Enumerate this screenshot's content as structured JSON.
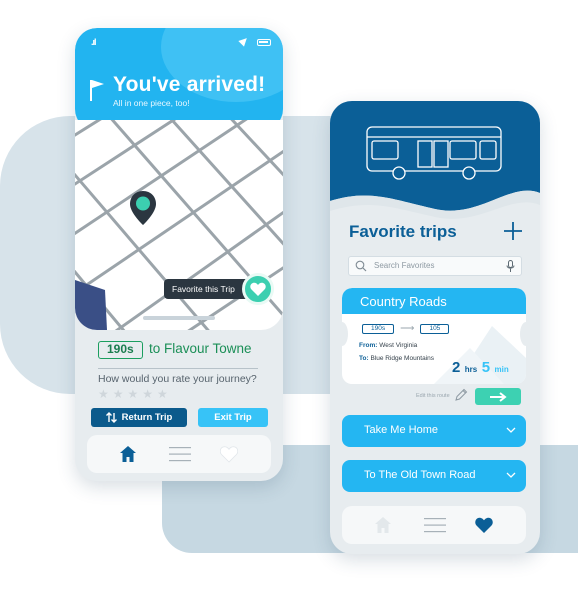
{
  "arrival_screen": {
    "title": "You've arrived!",
    "subtitle": "All in one piece, too!",
    "favorite_tag": "Favorite this Trip",
    "route_badge": "190s",
    "destination": "to Flavour Towne",
    "rating_question": "How would you rate your journey?",
    "rating_stars": "★★★★★",
    "return_trip_label": "Return Trip",
    "exit_trip_label": "Exit Trip",
    "icons": [
      "signal-icon",
      "location-arrow-icon",
      "battery-icon",
      "flag-icon",
      "map-pin-icon",
      "heart-icon",
      "swap-arrows-icon",
      "home-icon",
      "menu-icon",
      "heart-icon"
    ]
  },
  "favorites_screen": {
    "title": "Favorite trips",
    "search_placeholder": "Search Favorites",
    "expanded_trip": {
      "name": "Country Roads",
      "route_from_badge": "190s",
      "route_to_badge": "105",
      "from_label": "From:",
      "from_value": "West Virginia",
      "to_label": "To:",
      "to_value": "Blue Ridge Mountains",
      "hours": "2",
      "hours_unit": "hrs",
      "minutes": "5",
      "minutes_unit": "min",
      "edit_label": "Edit this route"
    },
    "trips": [
      {
        "name": "Take Me Home"
      },
      {
        "name": "To The Old Town Road"
      }
    ],
    "icons": [
      "bus-icon",
      "plus-icon",
      "search-icon",
      "microphone-icon",
      "pencil-icon",
      "arrow-right-icon",
      "chevron-down-icon",
      "home-icon",
      "menu-icon",
      "heart-icon"
    ]
  },
  "colors": {
    "accent_blue": "#24b6f2",
    "navy": "#0b5f97",
    "teal": "#3dd1b2",
    "green": "#1b8f57",
    "map_dark": "#2b3640"
  }
}
